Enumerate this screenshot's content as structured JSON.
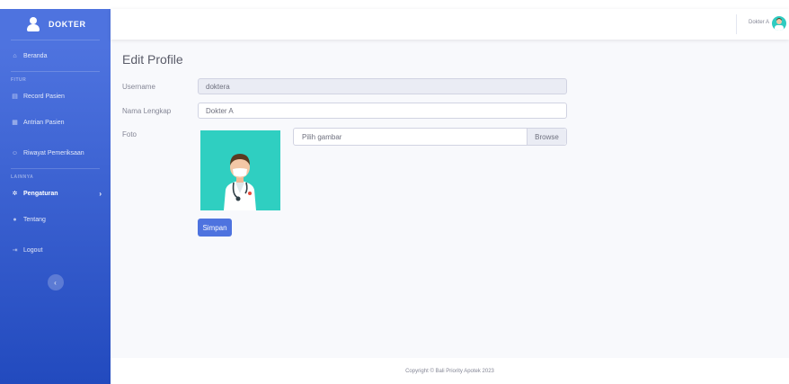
{
  "brand": {
    "name": "DOKTER"
  },
  "sidebar": {
    "items": [
      {
        "label": "Beranda",
        "icon": "home-icon"
      },
      {
        "heading": "FITUR"
      },
      {
        "label": "Record Pasien",
        "icon": "table-icon"
      },
      {
        "label": "Antrian Pasien",
        "icon": "list-icon"
      },
      {
        "label": "Riwayat Pemeriksaan",
        "icon": "user-history-icon"
      },
      {
        "heading": "LAINNYA"
      },
      {
        "label": "Pengaturan",
        "icon": "gear-icon",
        "active": true
      },
      {
        "label": "Tentang",
        "icon": "info-icon"
      },
      {
        "label": "Logout",
        "icon": "sign-out-icon"
      }
    ],
    "toggle": "‹"
  },
  "topbar": {
    "user_name": "Dokter A"
  },
  "page": {
    "title": "Edit Profile",
    "username_label": "Username",
    "username_value": "doktera",
    "fullname_label": "Nama Lengkap",
    "fullname_value": "Dokter A",
    "photo_label": "Foto",
    "file_placeholder": "Pilih gambar",
    "browse_label": "Browse",
    "save_label": "Simpan"
  },
  "footer": {
    "copyright": "Copyright © Bali Priority Apotek 2023"
  },
  "colors": {
    "primary": "#4e73df",
    "sidebar_dark": "#224abe",
    "avatar_bg": "#2fcfc1"
  }
}
